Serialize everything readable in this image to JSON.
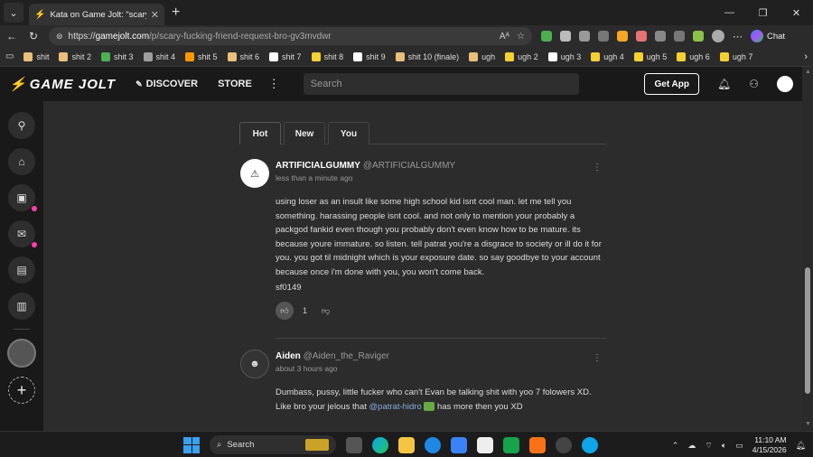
{
  "browser": {
    "tab_title": "Kata on Game Jolt: \"scary fucking f",
    "url_host": "gamejolt.com",
    "url_prefix": "https://",
    "url_path": "/p/scary-fucking-friend-request-bro-gv3mvdwr",
    "chat_label": "Chat"
  },
  "bookmarks": [
    {
      "label": "shit",
      "color": "#e8c07a"
    },
    {
      "label": "shit 2",
      "color": "#e8c07a"
    },
    {
      "label": "shit 3",
      "color": "#4caf50"
    },
    {
      "label": "shit 4",
      "color": "#9e9e9e"
    },
    {
      "label": "shit 5",
      "color": "#ff9800"
    },
    {
      "label": "shit 6",
      "color": "#e8c07a"
    },
    {
      "label": "shit 7",
      "color": "#ffffff"
    },
    {
      "label": "shit 8",
      "color": "#f5d033"
    },
    {
      "label": "shit 9",
      "color": "#ffffff"
    },
    {
      "label": "shit 10 (finale)",
      "color": "#e8c07a"
    },
    {
      "label": "ugh",
      "color": "#e8c07a"
    },
    {
      "label": "ugh 2",
      "color": "#f5d033"
    },
    {
      "label": "ugh 3",
      "color": "#ffffff"
    },
    {
      "label": "ugh 4",
      "color": "#f5d033"
    },
    {
      "label": "ugh 5",
      "color": "#f5d033"
    },
    {
      "label": "ugh 6",
      "color": "#f5d033"
    },
    {
      "label": "ugh 7",
      "color": "#f5d033"
    }
  ],
  "gamejolt": {
    "logo_text": "GAME JOLT",
    "discover_label": "DISCOVER",
    "store_label": "STORE",
    "search_placeholder": "Search",
    "get_app_label": "Get App"
  },
  "feed_tabs": [
    "Hot",
    "New",
    "You"
  ],
  "comments": [
    {
      "name": "ARTIFICIALGUMMY",
      "handle": "@ARTIFICIALGUMMY",
      "time": "less than a minute ago",
      "body": "using loser as an insult like some high school kid isnt cool man. let me tell you something. harassing people isnt cool. and not only to mention your probably a packgod fankid even though you probably don't even know how to be mature. its because youre immature. so listen. tell patrat you're a disgrace to society or ill do it for you. you got til midnight which is your exposure date. so say goodbye to your account because once i'm done with you, you won't come back.",
      "signature": "sf0149",
      "likes": "1"
    },
    {
      "name": "Aiden",
      "handle": "@Aiden_the_Raviger",
      "time": "about 3 hours ago",
      "body_before": "Dumbass, pussy, little fucker who can't Evan be talking shit with yoo 7 folowers XD. Like bro your jelous that ",
      "mention": "@patrat-hidro",
      "body_after": " has more then you XD"
    }
  ],
  "taskbar": {
    "search_label": "Search",
    "time": "11:10 AM",
    "date": "4/15/2026"
  },
  "colors": {
    "accent": "#ccff00",
    "notification_dot": "#ff3fac"
  }
}
